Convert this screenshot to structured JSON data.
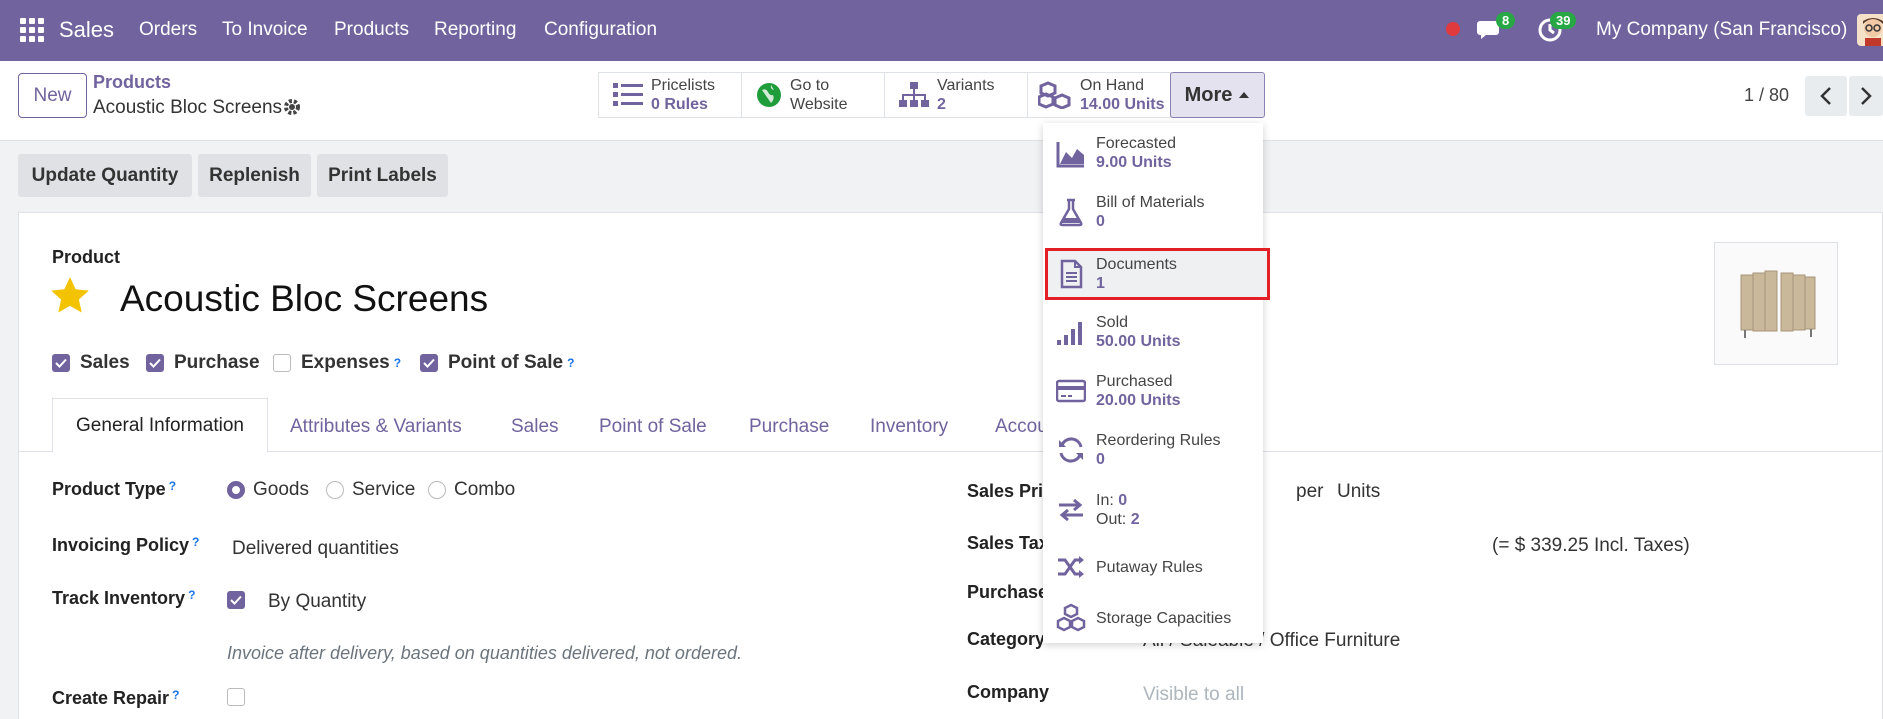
{
  "navbar": {
    "app": "Sales",
    "menu": [
      "Orders",
      "To Invoice",
      "Products",
      "Reporting",
      "Configuration"
    ],
    "chat_count": "8",
    "activity_count": "39",
    "company": "My Company (San Francisco)"
  },
  "control_panel": {
    "new_label": "New",
    "breadcrumb_parent": "Products",
    "breadcrumb_current": "Acoustic Bloc Screens",
    "stats": [
      {
        "label": "Pricelists",
        "value": "0 Rules"
      },
      {
        "label": "Go to",
        "value": "Website"
      },
      {
        "label": "Variants",
        "value": "2"
      },
      {
        "label": "On Hand",
        "value": "14.00 Units"
      }
    ],
    "more_label": "More",
    "pager": "1 / 80"
  },
  "dropdown": {
    "items": [
      {
        "title": "Forecasted",
        "value": "9.00 Units"
      },
      {
        "title": "Bill of Materials",
        "value": "0"
      },
      {
        "title": "Documents",
        "value": "1"
      },
      {
        "title": "Sold",
        "value": "50.00 Units"
      },
      {
        "title": "Purchased",
        "value": "20.00 Units"
      },
      {
        "title": "Reordering Rules",
        "value": "0"
      },
      {
        "in_label": "In:",
        "in_value": "0",
        "out_label": "Out:",
        "out_value": "2"
      },
      {
        "title": "Putaway Rules"
      },
      {
        "title": "Storage Capacities"
      }
    ]
  },
  "actions": [
    "Update Quantity",
    "Replenish",
    "Print Labels"
  ],
  "product": {
    "label": "Product",
    "name": "Acoustic Bloc Screens",
    "checkboxes": [
      {
        "label": "Sales",
        "checked": true
      },
      {
        "label": "Purchase",
        "checked": true
      },
      {
        "label": "Expenses",
        "checked": false
      },
      {
        "label": "Point of Sale",
        "checked": true
      }
    ]
  },
  "tabs": [
    "General Information",
    "Attributes & Variants",
    "Sales",
    "Point of Sale",
    "Purchase",
    "Inventory",
    "Accou"
  ],
  "fields": {
    "product_type_label": "Product Type",
    "product_type_options": [
      "Goods",
      "Service",
      "Combo"
    ],
    "invoicing_policy_label": "Invoicing Policy",
    "invoicing_policy_value": "Delivered quantities",
    "track_inventory_label": "Track Inventory",
    "track_inventory_value": "By Quantity",
    "invoice_note": "Invoice after delivery, based on quantities delivered, not ordered.",
    "create_repair_label": "Create Repair",
    "sales_price_label": "Sales Pric",
    "per_label": "per",
    "uom": "Units",
    "sales_taxes_label": "Sales Tax",
    "incl_taxes": "(= $ 339.25 Incl. Taxes)",
    "purchase_label": "Purchase",
    "category_label": "Category",
    "category_value": "All / Saleable / Office Furniture",
    "company_label": "Company",
    "company_placeholder": "Visible to all"
  },
  "colors": {
    "brand": "#71639e",
    "highlight": "#e31e24"
  }
}
